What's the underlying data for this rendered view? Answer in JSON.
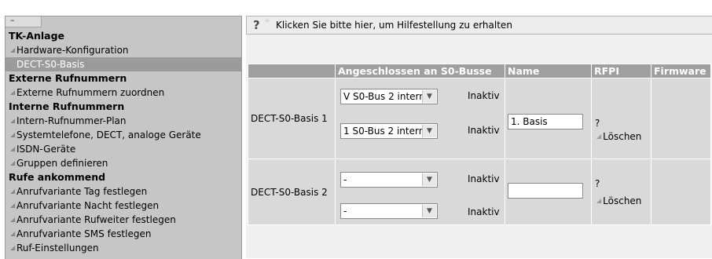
{
  "sidebar": {
    "collapse_label": "–",
    "entries": [
      {
        "type": "section",
        "label": "TK-Anlage",
        "name": "nav-section-tk-anlage"
      },
      {
        "type": "item",
        "label": "Hardware-Konfiguration",
        "name": "nav-item-hardware-konfiguration"
      },
      {
        "type": "active",
        "label": "DECT-S0-Basis",
        "name": "nav-item-dect-s0-basis"
      },
      {
        "type": "section",
        "label": "Externe Rufnummern",
        "name": "nav-section-externe-rufnummern"
      },
      {
        "type": "item",
        "label": "Externe Rufnummern zuordnen",
        "name": "nav-item-externe-rufnummern-zuordnen"
      },
      {
        "type": "section",
        "label": "Interne Rufnummern",
        "name": "nav-section-interne-rufnummern"
      },
      {
        "type": "item",
        "label": "Intern-Rufnummer-Plan",
        "name": "nav-item-intern-rufnummer-plan"
      },
      {
        "type": "item",
        "label": "Systemtelefone, DECT, analoge Geräte",
        "name": "nav-item-systemtelefone"
      },
      {
        "type": "item",
        "label": "ISDN-Geräte",
        "name": "nav-item-isdn-geraete"
      },
      {
        "type": "item",
        "label": "Gruppen definieren",
        "name": "nav-item-gruppen-definieren"
      },
      {
        "type": "section",
        "label": "Rufe ankommend",
        "name": "nav-section-rufe-ankommend"
      },
      {
        "type": "item",
        "label": "Anrufvariante Tag festlegen",
        "name": "nav-item-anrufvariante-tag"
      },
      {
        "type": "item",
        "label": "Anrufvariante Nacht festlegen",
        "name": "nav-item-anrufvariante-nacht"
      },
      {
        "type": "item",
        "label": "Anrufvariante Rufweiter festlegen",
        "name": "nav-item-anrufvariante-rufweiter"
      },
      {
        "type": "item",
        "label": "Anrufvariante SMS festlegen",
        "name": "nav-item-anrufvariante-sms"
      },
      {
        "type": "item",
        "label": "Ruf-Einstellungen",
        "name": "nav-item-ruf-einstellungen"
      }
    ]
  },
  "help": {
    "icon": "?",
    "plus": "+",
    "text": "Klicken Sie bitte hier, um Hilfestellung zu erhalten"
  },
  "table": {
    "headers": {
      "base": "",
      "connected": "Angeschlossen an S0-Busse",
      "name": "Name",
      "rfpi": "RFPI",
      "firmware": "Firmware"
    },
    "rows": [
      {
        "base": "DECT-S0-Basis 1",
        "bus1": {
          "value": "V S0-Bus 2 intern",
          "status": "Inaktiv"
        },
        "bus2": {
          "value": "1 S0-Bus 2 intern",
          "status": "Inaktiv"
        },
        "name_value": "1. Basis",
        "rfpi": "?",
        "delete": "Löschen",
        "firmware": ""
      },
      {
        "base": "DECT-S0-Basis 2",
        "bus1": {
          "value": "-",
          "status": "Inaktiv"
        },
        "bus2": {
          "value": "-",
          "status": "Inaktiv"
        },
        "name_value": "",
        "rfpi": "?",
        "delete": "Löschen",
        "firmware": ""
      }
    ]
  }
}
